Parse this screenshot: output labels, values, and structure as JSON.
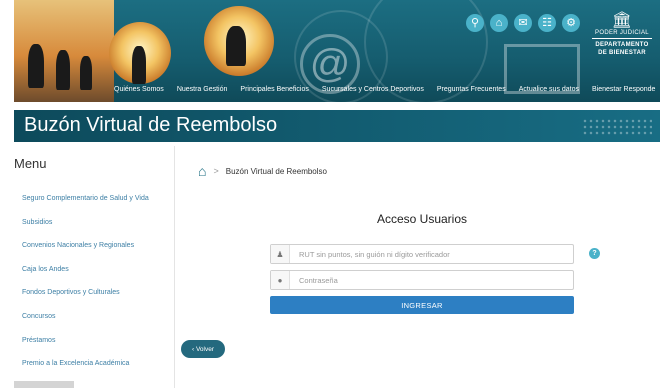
{
  "header": {
    "nav": [
      "Quiénes Somos",
      "Nuestra Gestión",
      "Principales Beneficios",
      "Sucursales y Centros Deportivos",
      "Preguntas Frecuentes",
      "Actualice sus datos",
      "Bienestar Responde"
    ],
    "top_icons": [
      "search-icon",
      "home-icon",
      "contact-icon",
      "sitemap-icon",
      "settings-icon"
    ],
    "logo": {
      "line1": "PODER JUDICIAL",
      "line2": "DEPARTAMENTO DE BIENESTAR"
    }
  },
  "page_title": "Buzón Virtual de Reembolso",
  "sidebar": {
    "title": "Menu",
    "items": [
      "Seguro Complementario de Salud y Vida",
      "Subsidios",
      "Convenios Nacionales y Regionales",
      "Caja los Andes",
      "Fondos Deportivos y Culturales",
      "Concursos",
      "Préstamos",
      "Premio a la Excelencia Académica"
    ]
  },
  "breadcrumb": {
    "current": "Buzón Virtual de Reembolso"
  },
  "login": {
    "heading": "Acceso Usuarios",
    "rut_placeholder": "RUT sin puntos, sin guión ni dígito verificador",
    "password_placeholder": "Contraseña",
    "submit_label": "INGRESAR"
  },
  "back_label": "Volver",
  "colors": {
    "header_teal": "#1c6e82",
    "button_blue": "#2d7fc3",
    "link_blue": "#3d7fa5"
  }
}
